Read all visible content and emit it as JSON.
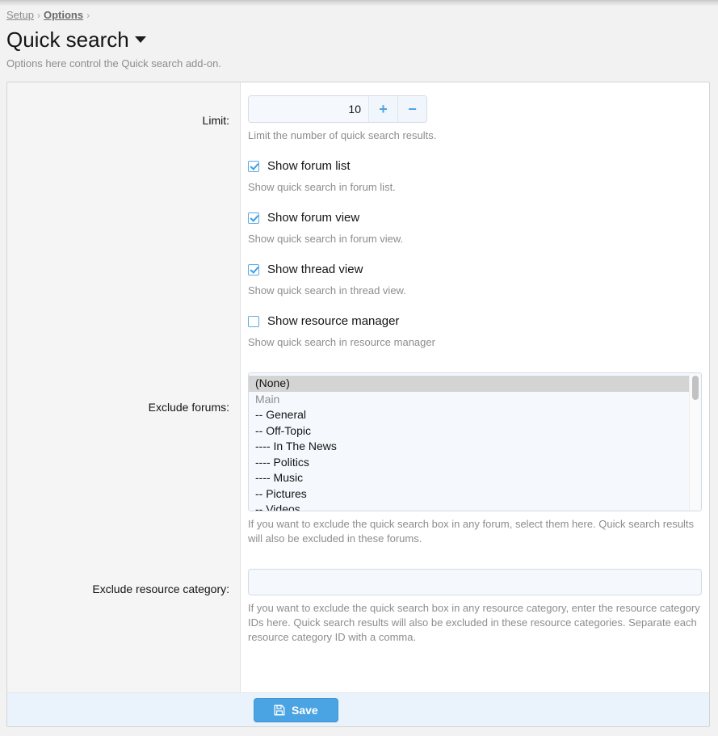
{
  "breadcrumb": {
    "items": [
      {
        "label": "Setup",
        "strong": false
      },
      {
        "label": "Options",
        "strong": true
      }
    ],
    "separator": "›"
  },
  "header": {
    "title": "Quick search",
    "title_caret_icon": "caret-down-icon",
    "description": "Options here control the Quick search add-on."
  },
  "form": {
    "limit": {
      "label": "Limit:",
      "value": "10",
      "placeholder": "",
      "increment_label": "+",
      "decrement_label": "−",
      "explain": "Limit the number of quick search results."
    },
    "checkboxes": [
      {
        "label": "Show forum list",
        "checked": true,
        "explain": "Show quick search in forum list."
      },
      {
        "label": "Show forum view",
        "checked": true,
        "explain": "Show quick search in forum view."
      },
      {
        "label": "Show thread view",
        "checked": true,
        "explain": "Show quick search in thread view."
      },
      {
        "label": "Show resource manager",
        "checked": false,
        "explain": "Show quick search in resource manager"
      }
    ],
    "exclude_forums": {
      "label": "Exclude forums:",
      "options": [
        {
          "text": "(None)",
          "selected": true,
          "group": false
        },
        {
          "text": "Main",
          "selected": false,
          "group": true
        },
        {
          "text": "-- General",
          "selected": false,
          "group": false
        },
        {
          "text": "-- Off-Topic",
          "selected": false,
          "group": false
        },
        {
          "text": "---- In The News",
          "selected": false,
          "group": false
        },
        {
          "text": "---- Politics",
          "selected": false,
          "group": false
        },
        {
          "text": "---- Music",
          "selected": false,
          "group": false
        },
        {
          "text": "-- Pictures",
          "selected": false,
          "group": false
        },
        {
          "text": "-- Videos",
          "selected": false,
          "group": false
        }
      ],
      "explain": "If you want to exclude the quick search box in any forum, select them here. Quick search results will also be excluded in these forums."
    },
    "exclude_resource_category": {
      "label": "Exclude resource category:",
      "value": "",
      "placeholder": "",
      "explain": "If you want to exclude the quick search box in any resource category, enter the resource category IDs here. Quick search results will also be excluded in these resource categories. Separate each resource category ID with a comma."
    }
  },
  "footer": {
    "save_label": "Save",
    "save_icon": "floppy-disk-icon"
  },
  "colors": {
    "accent": "#4aa3e2",
    "checkbox_border": "#5aaae0",
    "muted_text": "#8d8d8d",
    "panel_border": "#d4d4d4",
    "footer_bg": "#eaf3fb"
  }
}
